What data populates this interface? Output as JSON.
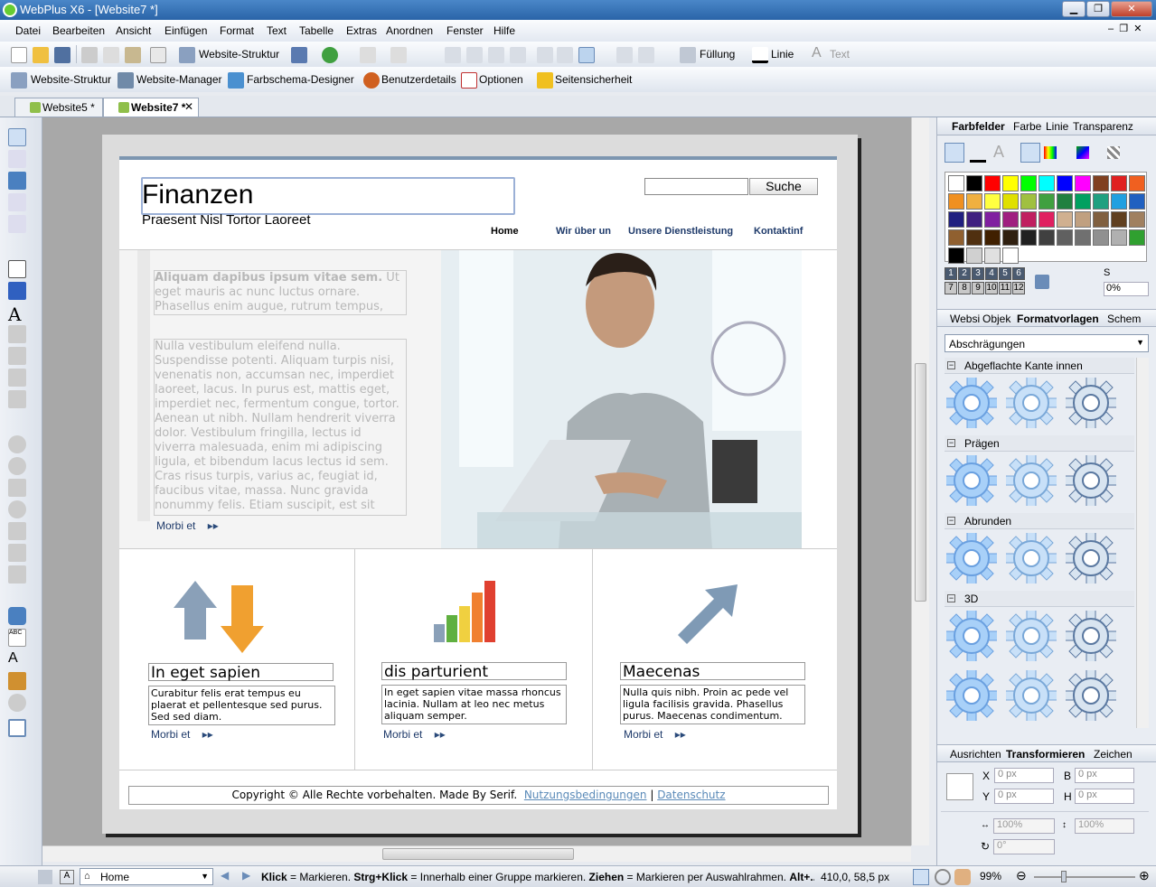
{
  "window": {
    "title": "WebPlus X6 - [Website7 *]"
  },
  "menu": [
    "Datei",
    "Bearbeiten",
    "Ansicht",
    "Einfügen",
    "Format",
    "Text",
    "Tabelle",
    "Extras",
    "Anordnen",
    "Fenster",
    "Hilfe"
  ],
  "toolbar1": {
    "site_structure": "Website-Struktur",
    "fill": "Füllung",
    "line": "Linie",
    "text": "Text"
  },
  "toolbar2": {
    "site_structure": "Website-Struktur",
    "site_manager": "Website-Manager",
    "scheme_designer": "Farbschema-Designer",
    "user_details": "Benutzerdetails",
    "options": "Optionen",
    "page_security": "Seitensicherheit"
  },
  "doc_tabs": [
    {
      "label": "Website5 *"
    },
    {
      "label": "Website7 *"
    }
  ],
  "site": {
    "title": "Finanzen",
    "subtitle": "Praesent Nisl Tortor Laoreet",
    "search_button": "Suche",
    "nav": [
      "Home",
      "Wir über un",
      "Unsere Dienstleistung",
      "Kontaktinf"
    ],
    "intro_bold": "Aliquam dapibus ipsum vitae sem.",
    "intro_rest": " Ut eget mauris ac nunc luctus ornare. Phasellus enim augue, rutrum tempus,",
    "body_text": "Nulla vestibulum eleifend nulla. Suspendisse potenti. Aliquam turpis nisi, venenatis non, accumsan nec, imperdiet laoreet, lacus. In purus est, mattis eget, imperdiet nec, fermentum congue, tortor. Aenean ut nibh. Nullam hendrerit viverra dolor. Vestibulum fringilla, lectus id viverra malesuada, enim mi adipiscing ligula, et bibendum lacus lectus id sem. Cras risus turpis, varius ac, feugiat id, faucibus vitae, massa. Nunc gravida nonummy felis. Etiam suscipit, est sit",
    "morbi_label": "Morbi et",
    "columns": [
      {
        "title": "In eget sapien",
        "text": "Curabitur felis erat tempus eu plaerat et pellentesque sed purus. Sed sed diam."
      },
      {
        "title": "dis parturient",
        "text": "In eget sapien vitae massa rhoncus lacinia. Nullam at leo nec metus aliquam semper."
      },
      {
        "title": "Maecenas",
        "text": "Nulla quis nibh. Proin ac pede vel ligula facilisis gravida. Phasellus purus. Maecenas condimentum."
      }
    ],
    "footer_text": "Copyright © Alle Rechte vorbehalten. Made By Serif.",
    "footer_link1": "Nutzungsbedingungen",
    "footer_sep": "|",
    "footer_link2": "Datenschutz"
  },
  "color_panel": {
    "tabs": [
      "Farbfelder",
      "Farbe",
      "Linie",
      "Transparenz"
    ],
    "palette_numbers": [
      "1",
      "2",
      "3",
      "4",
      "5",
      "6",
      "7",
      "8",
      "9",
      "10",
      "11",
      "12"
    ],
    "shade_label": "S",
    "shade_value": "0%",
    "swatches": [
      "#ffffff",
      "#000000",
      "#ff0000",
      "#ffff00",
      "#00ff00",
      "#00ffff",
      "#0000ff",
      "#ff00ff",
      "#804020",
      "#e02020",
      "#f06020",
      "#f09020",
      "#f0b040",
      "#ffff40",
      "#e0e000",
      "#a0c040",
      "#40a040",
      "#208040",
      "#00a060",
      "#20a080",
      "#20a0e0",
      "#2060c0",
      "#202080",
      "#402080",
      "#8020a0",
      "#a02080",
      "#c02060",
      "#e02060",
      "#d0b090",
      "#c0a080",
      "#806040",
      "#604020",
      "#a08060",
      "#906030",
      "#503010",
      "#402000",
      "#302010",
      "#202020",
      "#404040",
      "#606060",
      "#707070",
      "#909090",
      "#b0b0b0",
      "#30a030",
      "#000000",
      "#d0d0d0",
      "#e0e0e0",
      "#ffffff"
    ]
  },
  "styles_panel": {
    "tabs": [
      "Websi",
      "Objek",
      "Formatvorlagen",
      "Schem"
    ],
    "dropdown": "Abschrägungen",
    "sections": [
      "Abgeflachte Kante innen",
      "Prägen",
      "Abrunden",
      "3D"
    ]
  },
  "transform_panel": {
    "tabs": [
      "Ausrichten",
      "Transformieren",
      "Zeichen"
    ],
    "x_label": "X",
    "x_value": "0 px",
    "y_label": "Y",
    "y_value": "0 px",
    "b_label": "B",
    "b_value": "0 px",
    "h_label": "H",
    "h_value": "0 px",
    "scale_w": "100%",
    "scale_h": "100%",
    "rotation": "0°"
  },
  "status": {
    "page": "Home",
    "hint_1": "Klick",
    "hint_2": " = Markieren. ",
    "hint_3": "Strg+Klick",
    "hint_4": " = Innerhalb einer Gruppe markieren. ",
    "hint_5": "Ziehen",
    "hint_6": " = Markieren per Auswahlrahmen. ",
    "hint_7": "Alt+...",
    "coords": "410,0, 58,5 px",
    "zoom": "99%"
  }
}
